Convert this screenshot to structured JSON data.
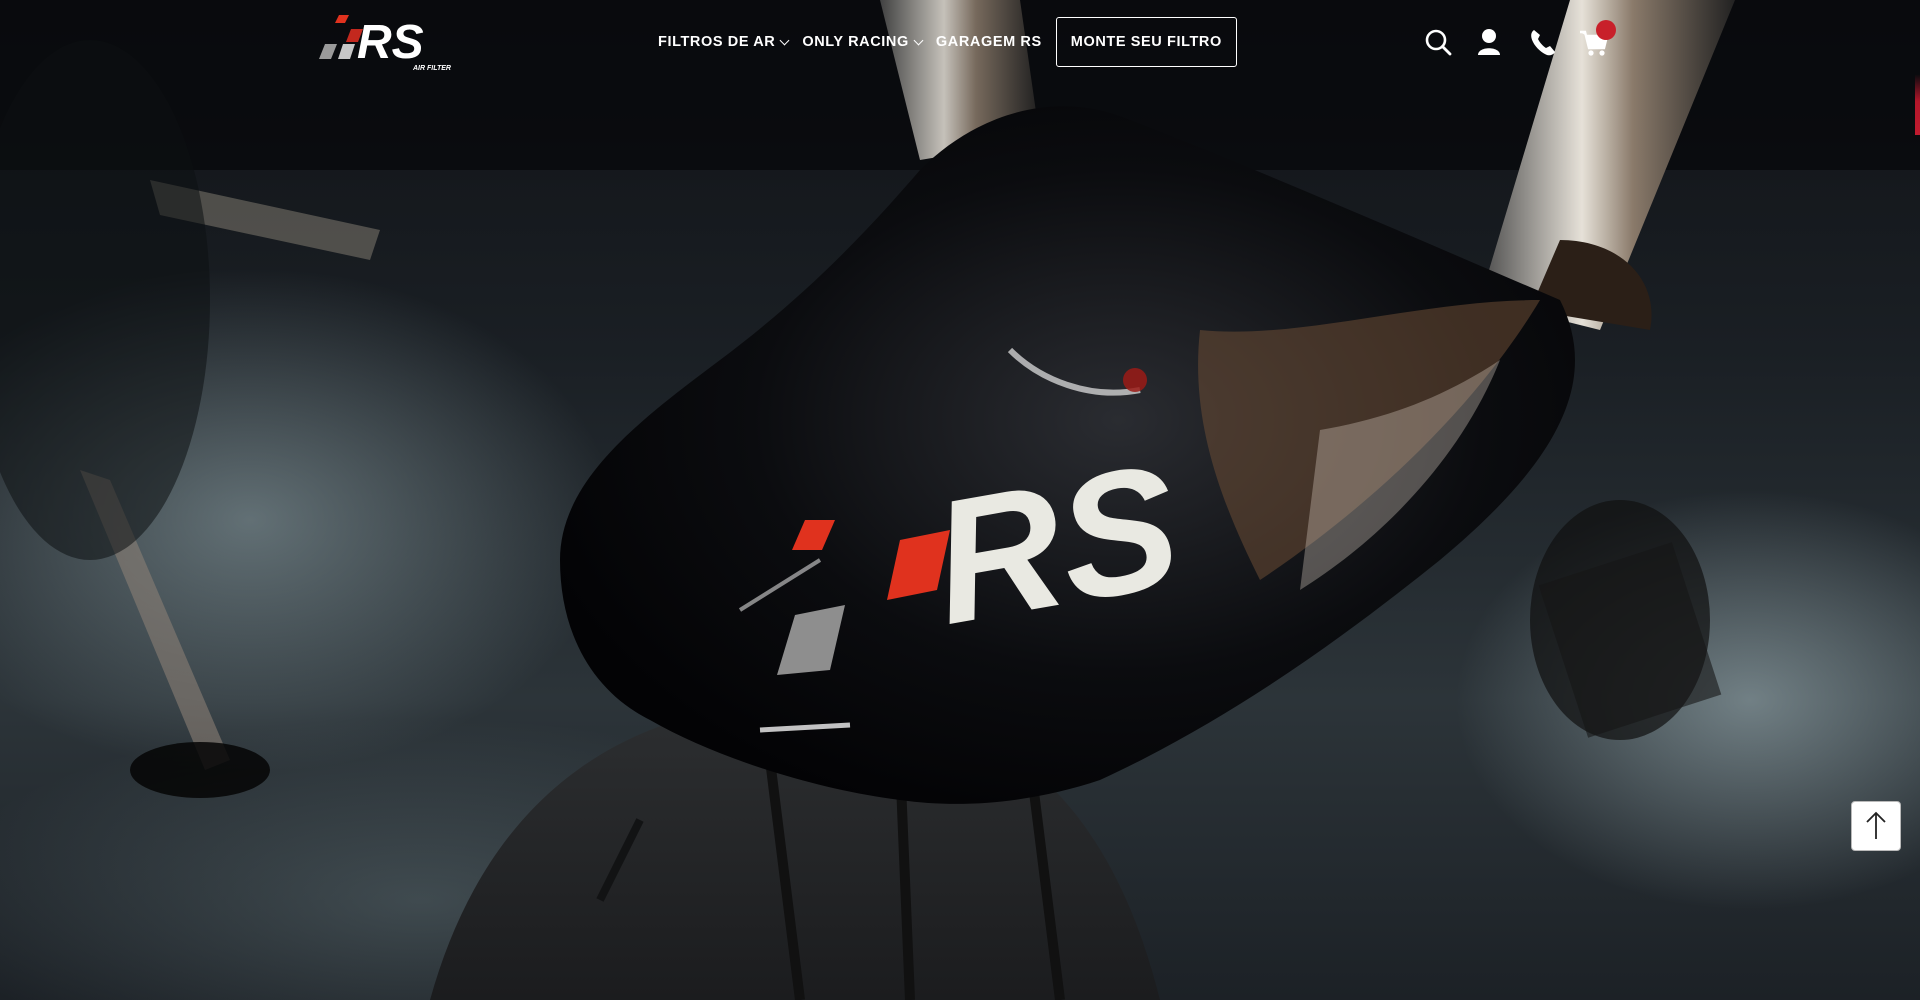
{
  "header": {
    "logo": {
      "brand": "RS",
      "tagline": "AIR FILTER"
    },
    "nav": [
      {
        "label": "FILTROS DE AR",
        "has_dropdown": true
      },
      {
        "label": "ONLY RACING",
        "has_dropdown": true
      },
      {
        "label": "GARAGEM RS",
        "has_dropdown": false
      }
    ],
    "cta_label": "MONTE SEU FILTRO",
    "icons": [
      "search-icon",
      "user-icon",
      "phone-icon",
      "cart-icon"
    ]
  },
  "hero": {
    "fender_logo": "RS",
    "description_colors": {
      "brand_red": "#e0321e",
      "logo_gray": "#8e8e8e",
      "logo_white": "#e9e9e2"
    }
  },
  "colors": {
    "cart_badge": "#c8202a",
    "text": "#ffffff",
    "scroll_accent": "#c11b2f"
  },
  "back_to_top": {
    "icon": "arrow-up-icon"
  }
}
